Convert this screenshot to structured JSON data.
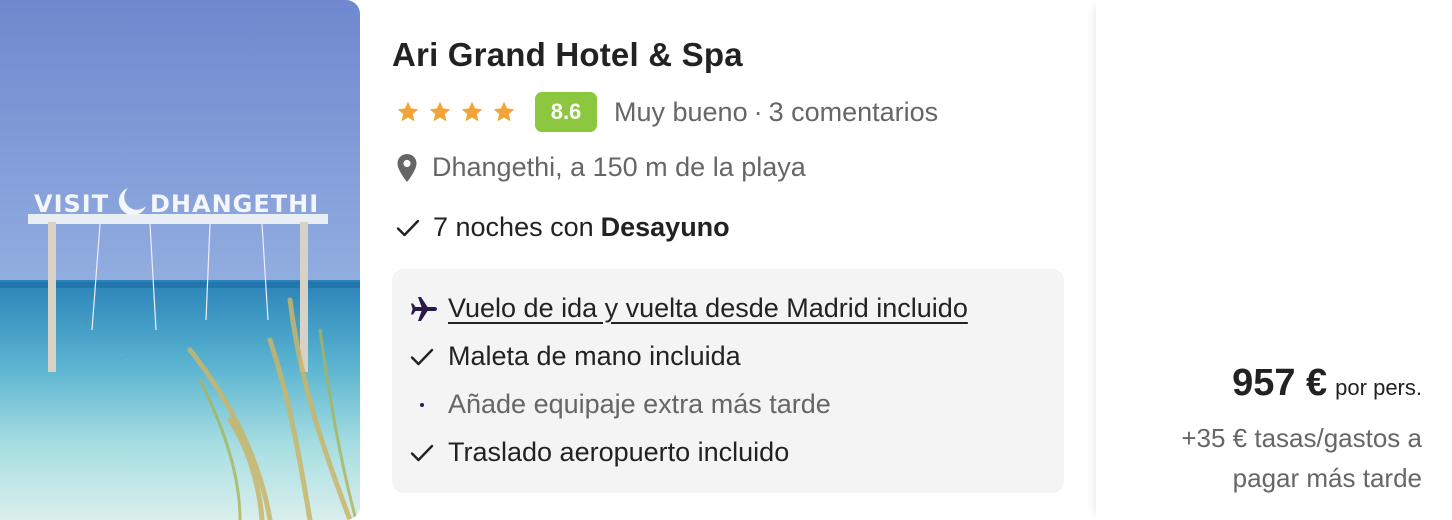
{
  "hotel": {
    "name": "Ari Grand Hotel & Spa",
    "stars": 4,
    "score": "8.6",
    "rating_label": "Muy bueno",
    "rating_separator": "·",
    "reviews": "3 comentarios",
    "location": "Dhangethi, a 150 m de la playa",
    "image_sign_text": "VISIT DHANGETHI"
  },
  "stay": {
    "nights_text": "7 noches con",
    "board": "Desayuno"
  },
  "extras": {
    "flight": "Vuelo de ida y vuelta desde Madrid incluido",
    "hand_luggage": "Maleta de mano incluida",
    "extra_luggage": "Añade equipaje extra más tarde",
    "transfer": "Traslado aeropuerto incluido"
  },
  "price": {
    "amount": "957 €",
    "per": "por pers.",
    "taxes": "+35 € tasas/gastos a pagar más tarde"
  },
  "colors": {
    "score_badge": "#8dc63f",
    "star": "#f2a33a",
    "flight_icon": "#2a1a4a"
  },
  "icons": {
    "star": "star-icon",
    "pin": "location-pin-icon",
    "check": "checkmark-icon",
    "plane": "airplane-icon",
    "dot": "bullet-dot-icon"
  }
}
